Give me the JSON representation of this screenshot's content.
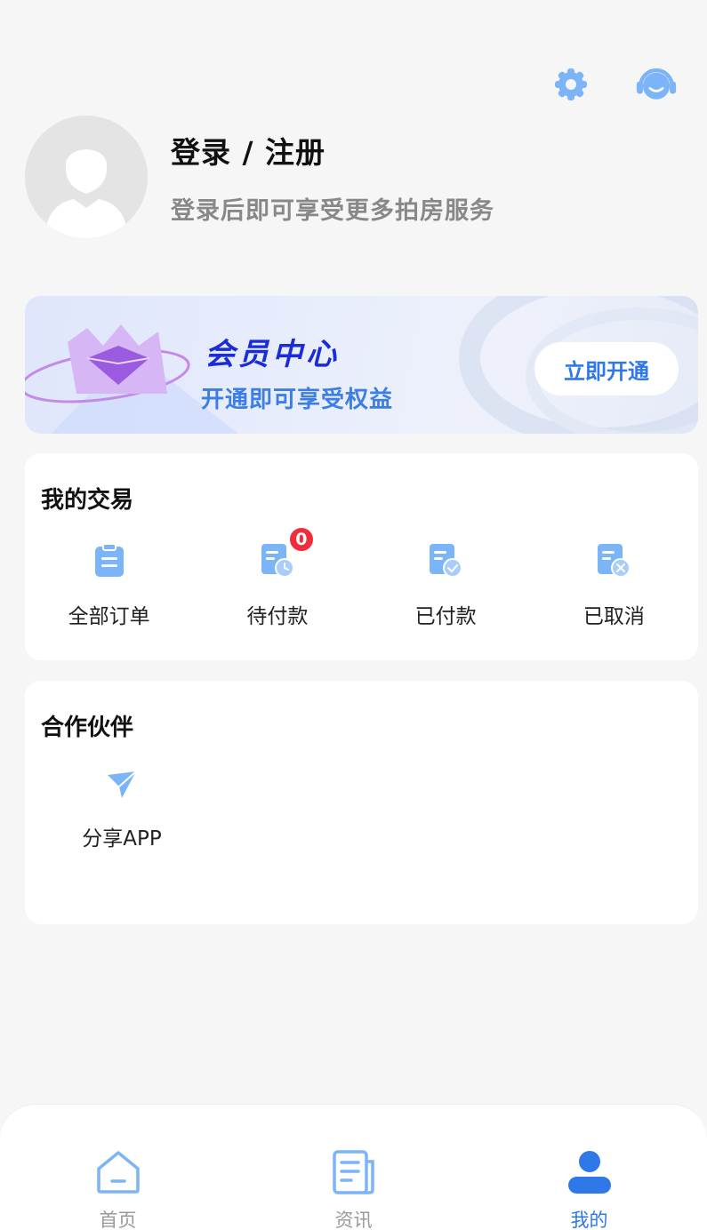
{
  "header": {
    "settings_icon": "gear-icon",
    "service_icon": "headset-icon"
  },
  "profile": {
    "title": "登录 / 注册",
    "subtitle": "登录后即可享受更多拍房服务"
  },
  "vip": {
    "title": "会员中心",
    "subtitle": "开通即可享受权益",
    "button_label": "立即开通"
  },
  "trade": {
    "title": "我的交易",
    "items": [
      {
        "label": "全部订单",
        "icon": "clipboard-icon"
      },
      {
        "label": "待付款",
        "icon": "pending-payment-icon",
        "badge": "0"
      },
      {
        "label": "已付款",
        "icon": "paid-icon"
      },
      {
        "label": "已取消",
        "icon": "cancelled-icon"
      }
    ]
  },
  "partner": {
    "title": "合作伙伴",
    "items": [
      {
        "label": "分享APP",
        "icon": "paper-plane-icon"
      }
    ]
  },
  "tabbar": {
    "tabs": [
      {
        "label": "首页",
        "icon": "home-icon"
      },
      {
        "label": "资讯",
        "icon": "news-icon"
      },
      {
        "label": "我的",
        "icon": "user-icon",
        "active": true
      }
    ]
  },
  "colors": {
    "accent": "#2f78e8",
    "icon_blue": "#7cb4f8",
    "vip_title": "#1a2bd8",
    "badge": "#f02d3b"
  }
}
